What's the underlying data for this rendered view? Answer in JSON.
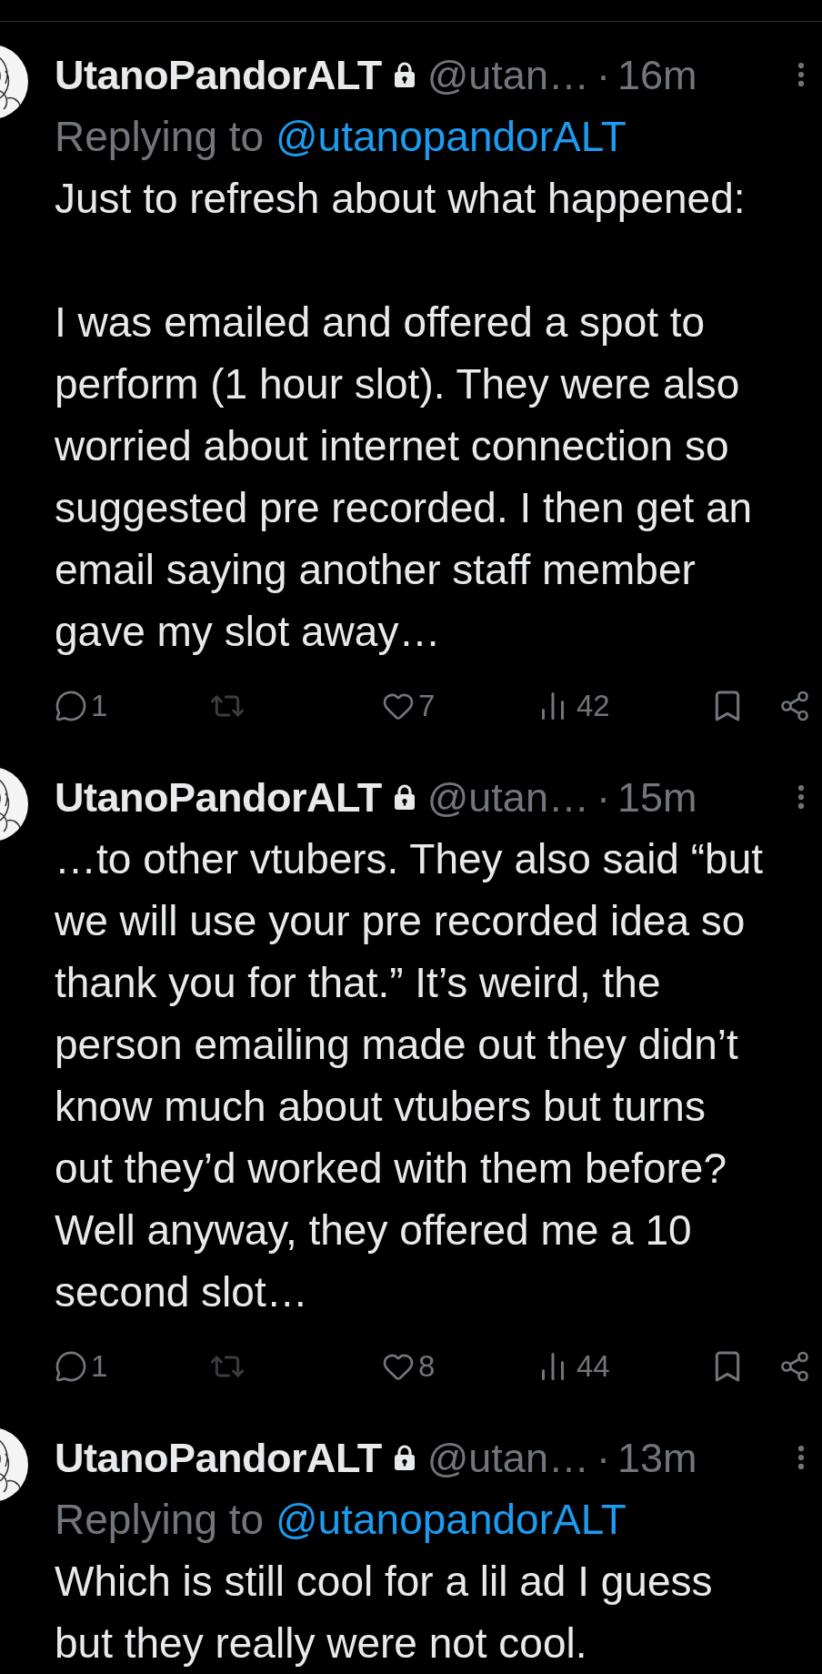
{
  "tweets": [
    {
      "name": "UtanoPandorALT",
      "handle": "@utan…",
      "separator": "·",
      "time": "16m",
      "replying": {
        "prefix": "Replying to",
        "handle": "@utanopandorALT"
      },
      "paragraphs": [
        [
          "Just to refresh about what happened:"
        ],
        [
          "I was emailed and offered a spot to",
          "perform (1 hour slot). They were also",
          "worried about internet connection so",
          "suggested pre recorded. I then get an",
          "email saying another staff member",
          "gave my slot away…"
        ]
      ],
      "actions": {
        "replies": "1",
        "retweet_disabled": true,
        "likes": "7",
        "views": "42"
      }
    },
    {
      "name": "UtanoPandorALT",
      "handle": "@utan…",
      "separator": "·",
      "time": "15m",
      "paragraphs": [
        [
          "…to other vtubers. They also said “but",
          "we will use your pre recorded idea so",
          "thank you for that.” It’s weird, the",
          "person emailing made out they didn’t",
          "know much about vtubers but turns",
          "out they’d worked with them before?",
          "Well anyway, they offered me a 10",
          "second slot…"
        ]
      ],
      "actions": {
        "replies": "1",
        "retweet_disabled": true,
        "likes": "8",
        "views": "44"
      }
    },
    {
      "name": "UtanoPandorALT",
      "handle": "@utan…",
      "separator": "·",
      "time": "13m",
      "replying": {
        "prefix": "Replying to",
        "handle": "@utanopandorALT"
      },
      "paragraphs": [
        [
          "Which is still cool for a lil ad I guess",
          "but they really were not cool."
        ]
      ]
    }
  ]
}
